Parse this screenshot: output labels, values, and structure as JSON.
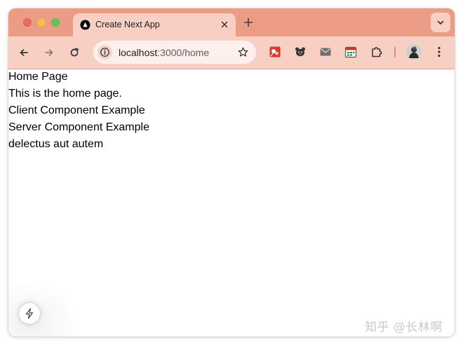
{
  "tab": {
    "title": "Create Next App",
    "favicon": "nextjs-icon"
  },
  "address_bar": {
    "host": "localhost",
    "rest": ":3000/home"
  },
  "extensions": [
    "extension-1-icon",
    "bear-icon",
    "mail-icon",
    "calendar-icon",
    "puzzle-icon"
  ],
  "page": {
    "lines": [
      "Home Page",
      "This is the home page.",
      "Client Component Example",
      "Server Component Example",
      "delectus aut autem"
    ]
  },
  "watermark": "知乎 @长林啊",
  "colors": {
    "tabstrip": "#ec9b85",
    "toolbar": "#f8cfc3"
  }
}
